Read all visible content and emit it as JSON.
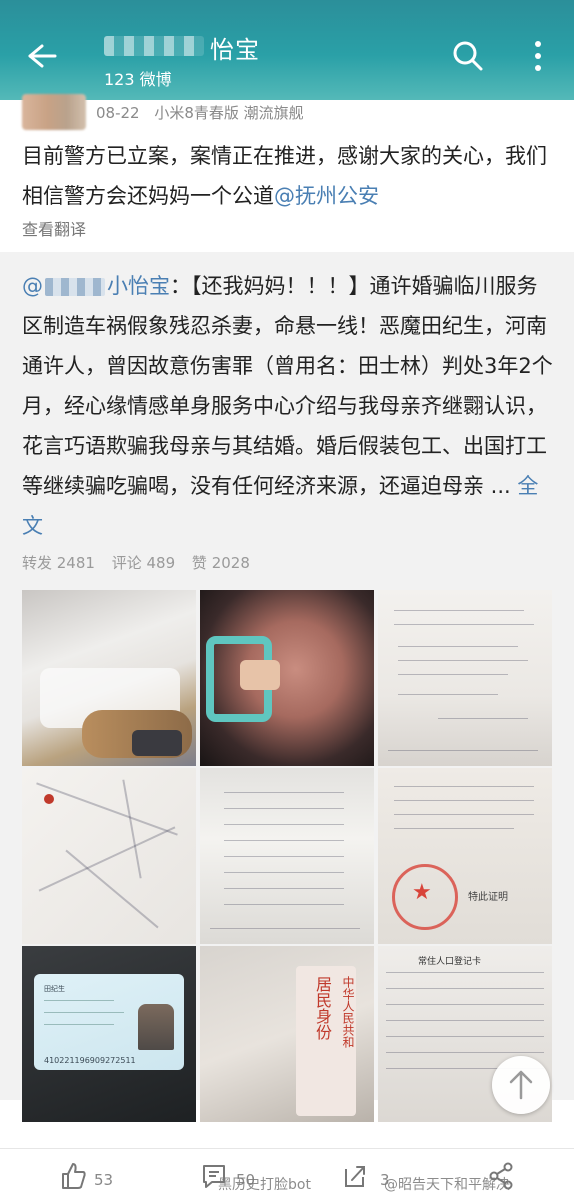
{
  "header": {
    "title": "怡宝",
    "subtitle": "123 微博"
  },
  "post": {
    "date": "08-22",
    "device": "小米8青春版 潮流旗舰",
    "text_before": "目前警方已立案，案情正在推进，感谢大家的关心，我们相信警方会还妈妈一个公道",
    "mention": "@抚州公安",
    "translate": "查看翻译"
  },
  "repost": {
    "prefix": "@",
    "user": "小怡宝",
    "text": "：【还我妈妈！！！】通许婚骗临川服务区制造车祸假象残忍杀妻，命悬一线！恶魔田纪生，河南通许人，曾因故意伤害罪（曾用名：田士林）判处3年2个月，经心缘情感单身服务中心介绍与我母亲齐继翾认识，花言巧语欺骗我母亲与其结婚。婚后假装包工、出国打工等继续骗吃骗喝，没有任何经济来源，还逼迫母亲 ...",
    "full_link": "全文",
    "forwards": "转发 2481",
    "comments": "评论 489",
    "likes": "赞 2028"
  },
  "photos": {
    "card_name": "田纪生",
    "card_number": "410221196909272511",
    "residence_title": "居民身份",
    "residence_country": "中华人民共和",
    "register_title": "常住人口登记卡",
    "cert_stamp_text": "特此证明"
  },
  "bottom": {
    "like_count": "53",
    "comment_count": "50",
    "share_count": "3",
    "watermark_left": "黑历史打脸bot",
    "watermark_right": "@昭告天下和平解决"
  },
  "colors": {
    "topbar": "#2aa0a7",
    "link": "#4a7fb3",
    "repost_bg": "#f2f2f2"
  }
}
